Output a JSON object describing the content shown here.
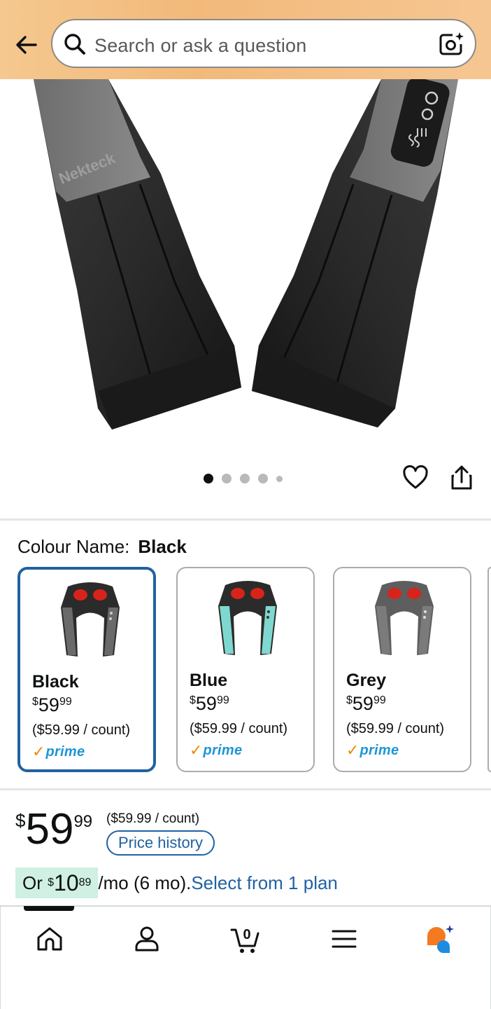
{
  "header": {
    "search_placeholder": "Search or ask a question",
    "back_icon": "arrow-left-icon",
    "search_icon": "magnifier-icon",
    "camera_icon": "camera-sparkle-icon",
    "bg_color": "#f2b97a"
  },
  "gallery": {
    "image_count": 5,
    "active_index": 0,
    "brand_mark": "Nekteck",
    "heart_icon": "heart-outline-icon",
    "share_icon": "share-icon"
  },
  "colour": {
    "label": "Colour Name:",
    "selected": "Black",
    "options": [
      {
        "name": "Black",
        "price_whole": "59",
        "price_cents": "99",
        "currency": "$",
        "unit_price": "($59.99 / count)",
        "prime": "prime",
        "accent": "#222222"
      },
      {
        "name": "Blue",
        "price_whole": "59",
        "price_cents": "99",
        "currency": "$",
        "unit_price": "($59.99 / count)",
        "prime": "prime",
        "accent": "#7fd8cf"
      },
      {
        "name": "Grey",
        "price_whole": "59",
        "price_cents": "99",
        "currency": "$",
        "unit_price": "($59.99 / count)",
        "prime": "prime",
        "accent": "#6e6e6e"
      }
    ]
  },
  "price": {
    "currency": "$",
    "whole": "59",
    "cents": "99",
    "unit_price": "($59.99 / count)",
    "history_label": "Price history"
  },
  "plan": {
    "prefix": "Or",
    "currency": "$",
    "whole": "10",
    "cents": "89",
    "suffix": "/mo (6 mo).",
    "link": "Select from 1 plan",
    "highlight_color": "#cff0e3"
  },
  "bottom_nav": {
    "items": [
      "home-icon",
      "account-icon",
      "cart-icon",
      "menu-icon",
      "rufus-icon"
    ],
    "cart_count": "0",
    "active": "home-icon"
  }
}
